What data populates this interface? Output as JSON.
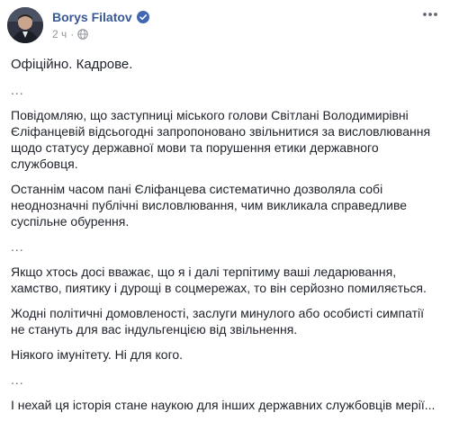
{
  "post": {
    "author": "Borys Filatov",
    "time": "2 ч",
    "meta_dot": "·",
    "paragraphs": {
      "p1": "Офіційно. Кадрове.",
      "sep1": "...",
      "p2": "Повідомляю, що заступниці міського голови Світлані Володимирівні Єліфанцевій відсьогодні запропоновано звільнитися за висловлювання щодо статусу державної мови та порушення етики державного службовця.",
      "p3": "Останнім часом пані Єліфанцева систематично дозволяла собі неоднозначні публічні висловлювання, чим викликала справедливе суспільне обурення.",
      "sep2": "...",
      "p4": "Якщо хтось досі вважає, що я і далі терпітиму ваші ледарювання, хамство, пиятику і дурощі в соцмережах, то він серйозно помиляється.",
      "p5": "Жодні політичні домовленості, заслуги минулого або особисті симпатії не стануть для вас індульгенцією від звільнення.",
      "p6": "Ніякого імунітету. Ні для кого.",
      "sep3": "...",
      "p7": "І нехай ця історія стане наукою для інших державних службовців мерії..."
    }
  },
  "icons": {
    "verified": "verified-badge-icon",
    "audience": "globe-icon",
    "more": "more-options-icon"
  },
  "colors": {
    "author": "#385898",
    "verified": "#4267b2",
    "meta": "#90949c",
    "text": "#1d2129"
  }
}
